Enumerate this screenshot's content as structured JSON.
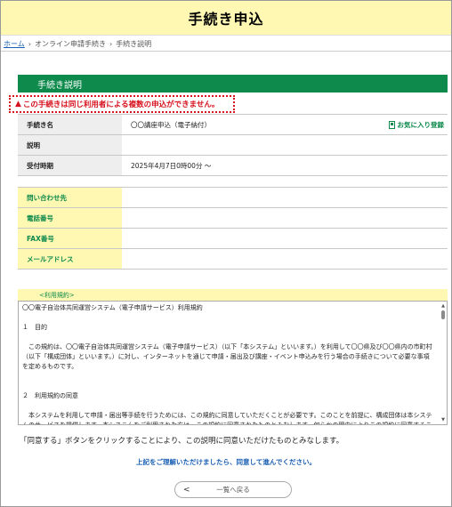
{
  "header": {
    "title": "手続き申込"
  },
  "breadcrumb": {
    "home": "ホーム",
    "sep1": "›",
    "item1": "オンライン申請手続き",
    "sep2": "›",
    "item2": "手続き説明"
  },
  "section": {
    "title": "手続き説明"
  },
  "warning": {
    "icon": "warning-icon",
    "text": "この手続きは同じ利用者による複数の申込ができません。"
  },
  "info_rows": [
    {
      "label": "手続き名",
      "value": "〇〇講座申込（電子納付）"
    },
    {
      "label": "説明",
      "value": ""
    },
    {
      "label": "受付時期",
      "value": "2025年4月7日0時00分 〜"
    }
  ],
  "favorite": {
    "label": "お気に入り登録",
    "icon": "bookmark-icon"
  },
  "contact_rows": [
    {
      "label": "問い合わせ先",
      "value": ""
    },
    {
      "label": "電話番号",
      "value": ""
    },
    {
      "label": "FAX番号",
      "value": ""
    },
    {
      "label": "メールアドレス",
      "value": ""
    }
  ],
  "terms": {
    "heading": "<利用規約>",
    "lines": [
      "〇〇電子自治体共同運営システム（電子申請サービス）利用規約",
      "",
      "１　目的",
      "",
      "　この規約は、〇〇電子自治体共同運営システム（電子申請サービス）（以下「本システム」といいます。）を利用して〇〇県及び〇〇県内の市町村（以下「構成団体」といいます。）に対し、インターネットを通じて申請・届出及び講座・イベント申込みを行う場合の手続きについて必要な事項を定めるものです。",
      "",
      "",
      "２　利用規約の同意",
      "",
      "　本システムを利用して申請・届出等手続を行うためには、この規約に同意していただくことが必要です。このことを前提に、構成団体は本システムのサービスを提供します。本システムをご利用された方は、この規約に同意されたものとみなします。何らかの理由によりこの規約に同意することができない場合は、本システムをご利用いただくことができません。なお、開塞のみについても、この規約に同意されたものとみなします。"
    ]
  },
  "agree_text": "「同意する」ボタンをクリックすることにより、この説明に同意いただけたものとみなします。",
  "proceed_text": "上記をご理解いただけましたら、同意して進んでください。",
  "back_button": {
    "label": "一覧へ戻る",
    "icon": "chevron-left-icon"
  },
  "colors": {
    "accent": "#0e8a4c",
    "header_bg": "#fff8b3",
    "warning": "#d7111d",
    "link": "#1a5fb4"
  }
}
